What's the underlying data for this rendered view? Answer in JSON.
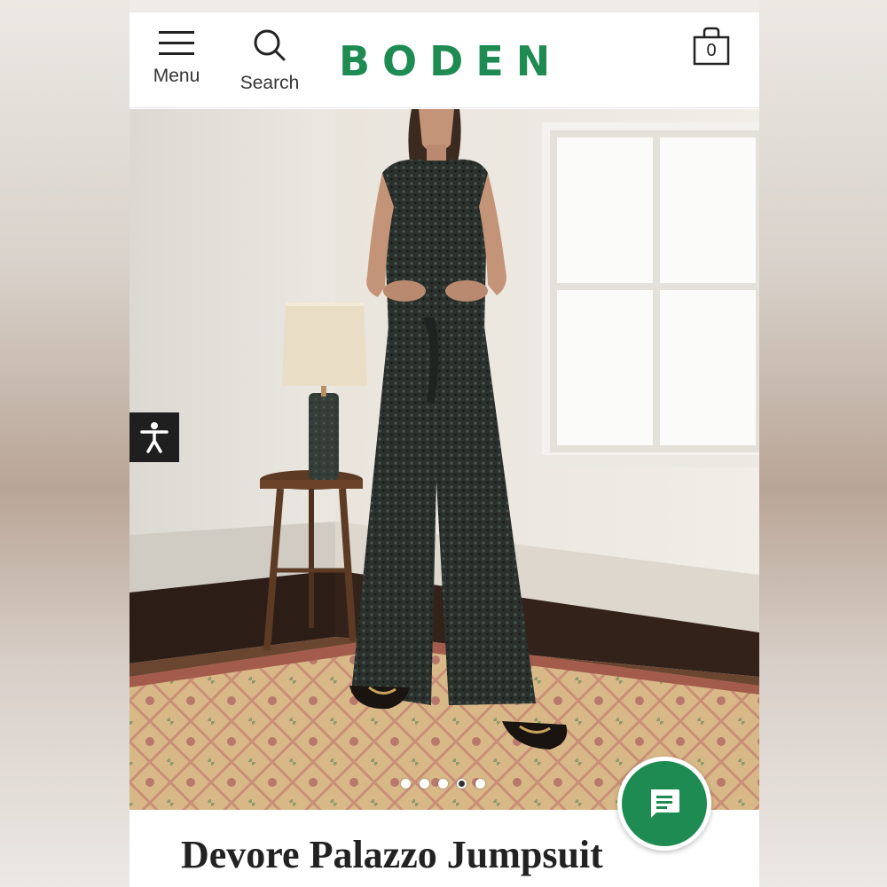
{
  "header": {
    "menu_label": "Menu",
    "search_label": "Search",
    "brand": "BODEN",
    "bag_count": "0"
  },
  "hero": {
    "slide_count": 5,
    "active_slide": 4
  },
  "product": {
    "title": "Devore Palazzo Jumpsuit"
  },
  "colors": {
    "brand_green": "#1e8c52",
    "accessibility_bg": "#1f1f1f"
  },
  "icons": {
    "menu": "hamburger-icon",
    "search": "search-icon",
    "bag": "shopping-bag-icon",
    "accessibility": "accessibility-icon",
    "chat": "chat-icon"
  }
}
